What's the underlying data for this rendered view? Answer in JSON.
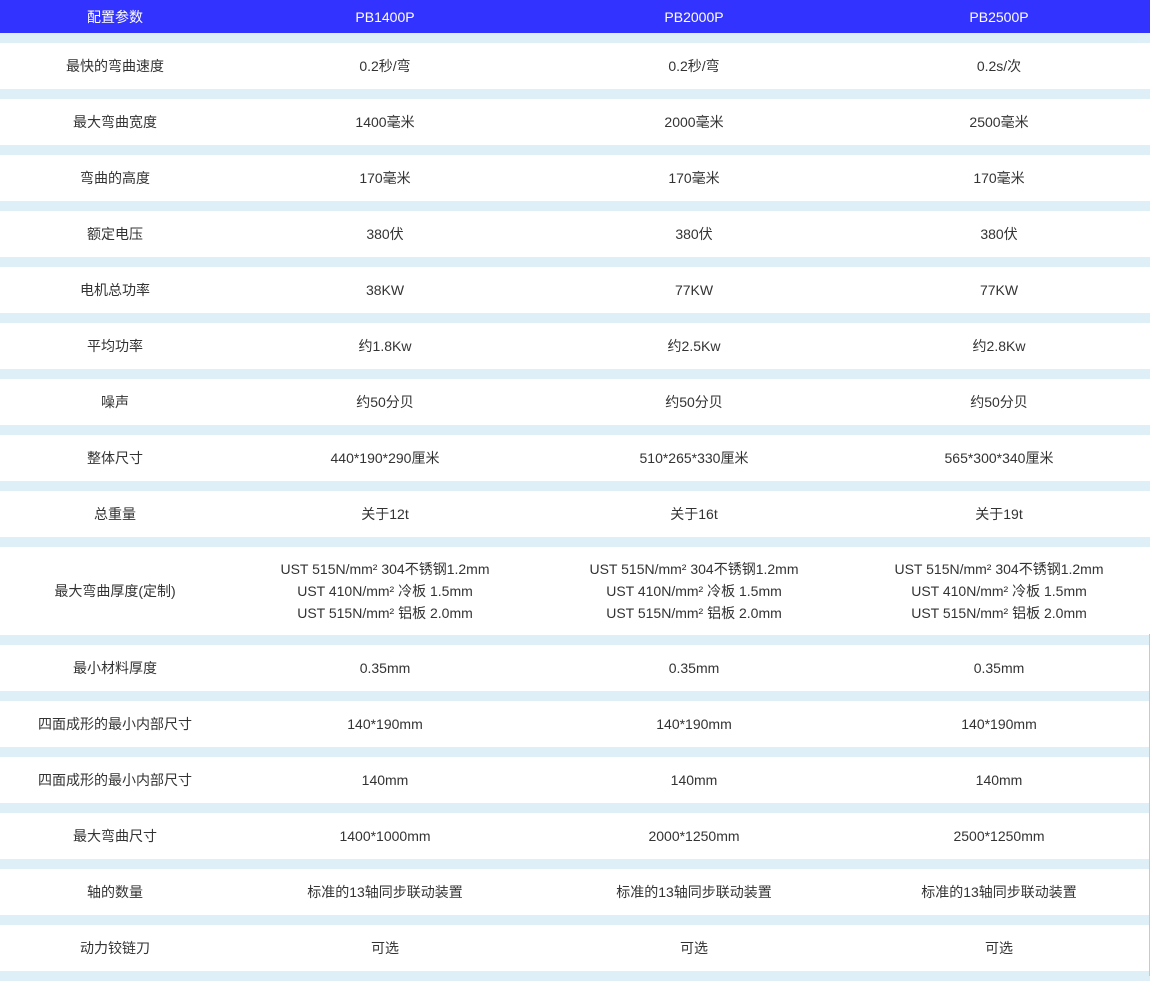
{
  "header": {
    "param_label": "配置参数",
    "models": [
      "PB1400P",
      "PB2000P",
      "PB2500P"
    ]
  },
  "rows": [
    {
      "label": "最快的弯曲速度",
      "values": [
        "0.2秒/弯",
        "0.2秒/弯",
        "0.2s/次"
      ]
    },
    {
      "label": "最大弯曲宽度",
      "values": [
        "1400毫米",
        "2000毫米",
        "2500毫米"
      ]
    },
    {
      "label": "弯曲的高度",
      "values": [
        "170毫米",
        "170毫米",
        "170毫米"
      ]
    },
    {
      "label": "额定电压",
      "values": [
        "380伏",
        "380伏",
        "380伏"
      ]
    },
    {
      "label": "电机总功率",
      "values": [
        "38KW",
        "77KW",
        "77KW"
      ]
    },
    {
      "label": "平均功率",
      "values": [
        "约1.8Kw",
        "约2.5Kw",
        "约2.8Kw"
      ]
    },
    {
      "label": "噪声",
      "values": [
        "约50分贝",
        "约50分贝",
        "约50分贝"
      ]
    },
    {
      "label": "整体尺寸",
      "values": [
        "440*190*290厘米",
        "510*265*330厘米",
        "565*300*340厘米"
      ]
    },
    {
      "label": "总重量",
      "values": [
        "关于12t",
        "关于16t",
        "关于19t"
      ]
    },
    {
      "label": "最大弯曲厚度(定制)",
      "values": [
        [
          "UST 515N/mm² 304不锈钢1.2mm",
          "UST 410N/mm² 冷板 1.5mm",
          "UST 515N/mm² 铝板 2.0mm"
        ],
        [
          "UST 515N/mm² 304不锈钢1.2mm",
          "UST 410N/mm² 冷板 1.5mm",
          "UST 515N/mm² 铝板 2.0mm"
        ],
        [
          "UST 515N/mm² 304不锈钢1.2mm",
          "UST 410N/mm² 冷板 1.5mm",
          "UST 515N/mm² 铝板 2.0mm"
        ]
      ]
    },
    {
      "label": "最小材料厚度",
      "values": [
        "0.35mm",
        "0.35mm",
        "0.35mm"
      ]
    },
    {
      "label": "四面成形的最小内部尺寸",
      "values": [
        "140*190mm",
        "140*190mm",
        "140*190mm"
      ]
    },
    {
      "label": "四面成形的最小内部尺寸",
      "values": [
        "140mm",
        "140mm",
        "140mm"
      ]
    },
    {
      "label": "最大弯曲尺寸",
      "values": [
        "1400*1000mm",
        "2000*1250mm",
        "2500*1250mm"
      ]
    },
    {
      "label": "轴的数量",
      "values": [
        "标准的13轴同步联动装置",
        "标准的13轴同步联动装置",
        "标准的13轴同步联动装置"
      ]
    },
    {
      "label": "动力铰链刀",
      "values": [
        "可选",
        "可选",
        "可选"
      ]
    }
  ]
}
